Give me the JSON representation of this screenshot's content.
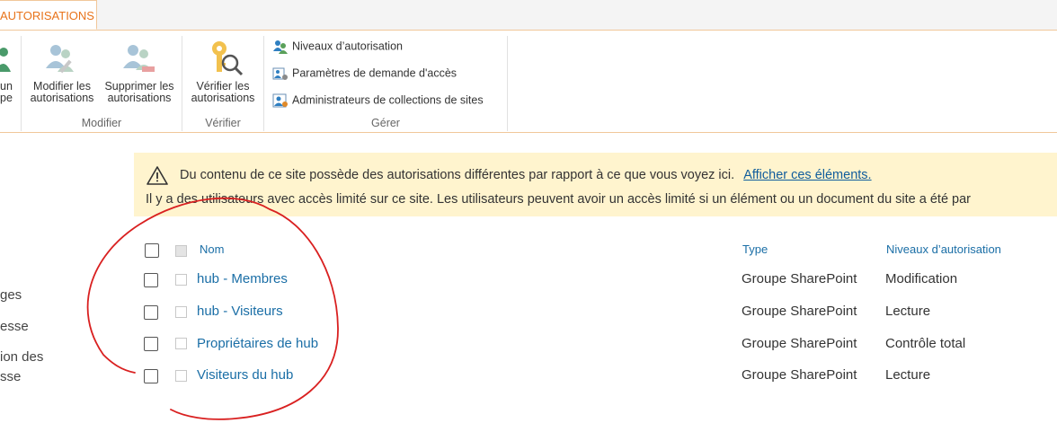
{
  "ribbon": {
    "active_tab": "AUTORISATIONS",
    "partial_button": {
      "line1": "un",
      "line2": "pe"
    },
    "modifier_group": {
      "label": "Modifier",
      "buttons": [
        {
          "line1": "Modifier les",
          "line2": "autorisations",
          "icon": "edit-permissions-icon"
        },
        {
          "line1": "Supprimer les",
          "line2": "autorisations",
          "icon": "remove-permissions-icon"
        }
      ]
    },
    "verifier_group": {
      "label": "Vérifier",
      "button": {
        "line1": "Vérifier les",
        "line2": "autorisations",
        "icon": "check-permissions-icon"
      }
    },
    "gerer_group": {
      "label": "Gérer",
      "items": [
        {
          "label": "Niveaux d’autorisation",
          "icon": "permission-levels-icon"
        },
        {
          "label": "Paramètres de demande d'accès",
          "icon": "access-request-icon"
        },
        {
          "label": "Administrateurs de collections de sites",
          "icon": "site-admins-icon"
        }
      ]
    }
  },
  "warning": {
    "line1": "Du contenu de ce site possède des autorisations différentes par rapport à ce que vous voyez ici.",
    "link": "Afficher ces éléments.",
    "line2": "Il y a des utilisateurs avec accès limité sur ce site. Les utilisateurs peuvent avoir un accès limité si un élément ou un document du site a été par"
  },
  "left_nav": [
    "ges",
    "esse",
    "ion des",
    "sse"
  ],
  "table": {
    "headers": {
      "name": "Nom",
      "type": "Type",
      "level": "Niveaux d’autorisation"
    },
    "rows": [
      {
        "name": "hub - Membres",
        "type": "Groupe SharePoint",
        "level": "Modification"
      },
      {
        "name": "hub - Visiteurs",
        "type": "Groupe SharePoint",
        "level": "Lecture"
      },
      {
        "name": "Propriétaires de hub",
        "type": "Groupe SharePoint",
        "level": "Contrôle total"
      },
      {
        "name": "Visiteurs du hub",
        "type": "Groupe SharePoint",
        "level": "Lecture"
      }
    ]
  },
  "colors": {
    "accent_orange": "#e8731a",
    "link_blue": "#1a6ea6",
    "warning_bg": "#fff4ce",
    "annotation_red": "#d92020"
  }
}
